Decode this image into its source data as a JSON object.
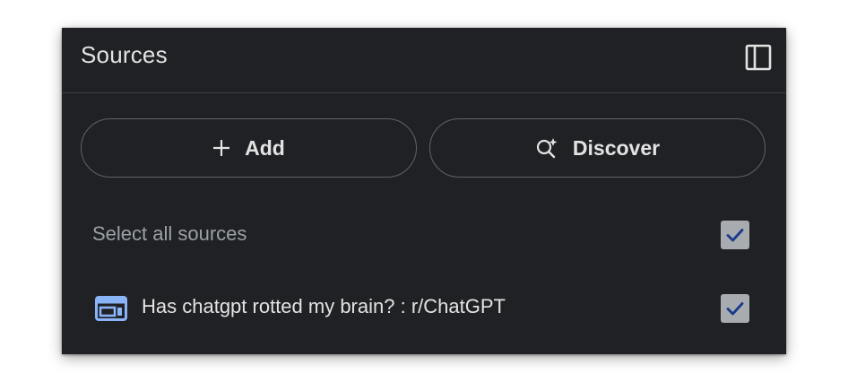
{
  "panel": {
    "title": "Sources",
    "collapse_icon": "side-panel-icon"
  },
  "actions": {
    "add_label": "Add",
    "add_icon": "plus-icon",
    "discover_label": "Discover",
    "discover_icon": "sparkle-search-icon"
  },
  "select_all": {
    "label": "Select all sources",
    "checked": true
  },
  "sources": [
    {
      "label": "Has chatgpt rotted my brain? : r/ChatGPT",
      "icon": "web-page-icon",
      "checked": true
    }
  ],
  "colors": {
    "panel_bg": "#202124",
    "text": "#e3e3e3",
    "muted_text": "#9aa0a6",
    "checkbox_bg": "#a8abb0",
    "checkmark": "#1a3a8a",
    "source_icon": "#8ab4f8"
  }
}
